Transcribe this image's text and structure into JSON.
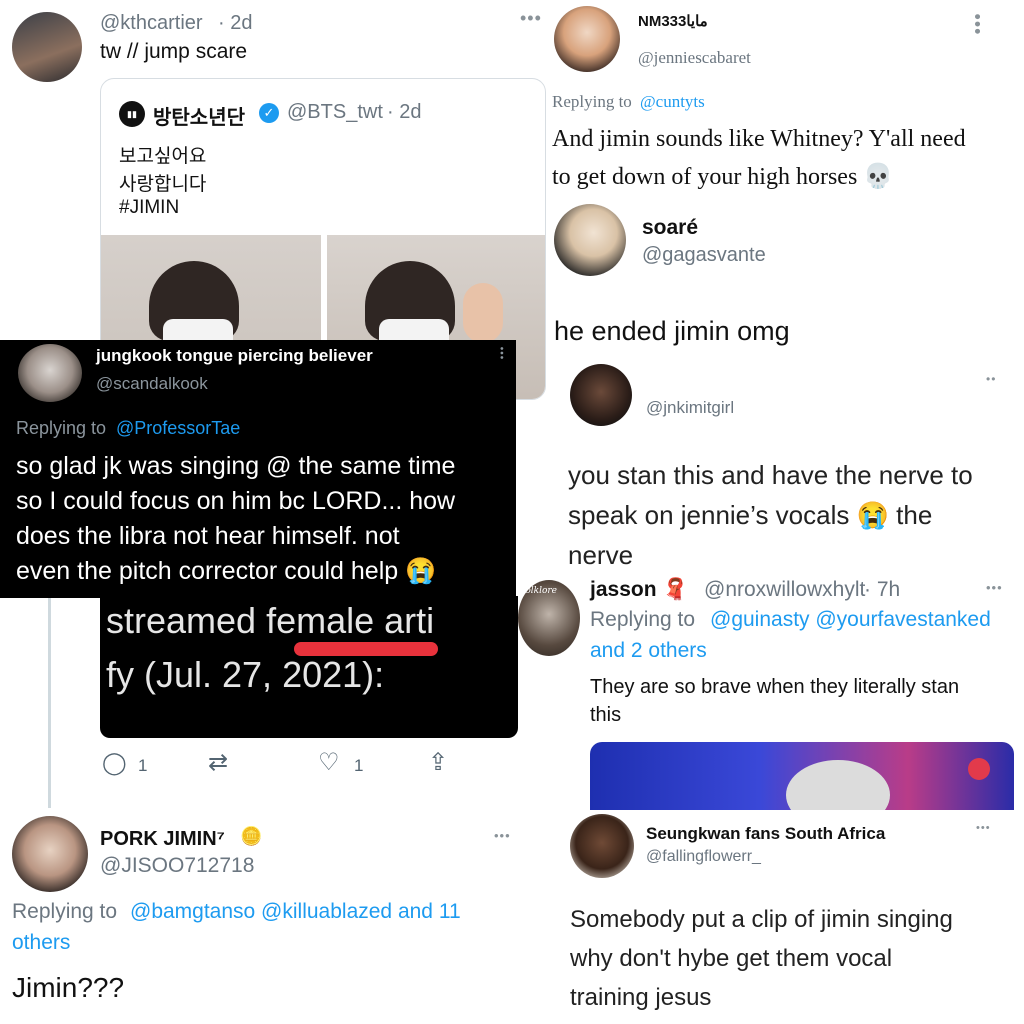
{
  "p1": {
    "name": "@kthcartier",
    "time": "· 2d",
    "text": "tw // jump scare",
    "quote": {
      "name": "방탄소년단",
      "handle": "@BTS_twt",
      "time": "· 2d",
      "line1": "보고싶어요",
      "line2": "사랑합니다",
      "line3": "#JIMIN"
    },
    "overlay": {
      "line1": "streamed female arti",
      "line2": "fy (Jul. 27, 2021):"
    },
    "actions": {
      "replies": "1",
      "likes": "1"
    }
  },
  "p2": {
    "name": "NMمايا333",
    "handle": "@jenniescabaret",
    "replying_label": "Replying to",
    "replying_to": "@cuntyts",
    "line1": "And jimin sounds like Whitney? Y'all need",
    "line2": "to get down of your high horses 💀"
  },
  "p3": {
    "name": "soaré",
    "handle": "@gagasvante",
    "text": "he ended jimin omg"
  },
  "p4": {
    "name": "jungkook tongue piercing believer",
    "handle": "@scandalkook",
    "replying_label": "Replying to",
    "replying_to": "@ProfessorTae",
    "line1": "so glad jk was singing @ the same time",
    "line2": "so I could focus on him bc LORD... how",
    "line3": "does the libra not hear himself. not",
    "line4": "even the pitch corrector could help 😭"
  },
  "p5": {
    "handle": "@jnkimitgirl",
    "line1": "you stan this and have the nerve to",
    "line2": "speak on jennie’s vocals 😭 the",
    "line3": "nerve"
  },
  "p6": {
    "name": "jasson 🧣",
    "handle": "@nroxwillowxhylt",
    "time": "· 7h",
    "replying_label": "Replying to",
    "replying_to": "@guinasty @yourfavestanked",
    "replying_more": "and 2 others",
    "line1": "They are so brave when they literally stan",
    "line2": "this",
    "avatar_text": "folklore"
  },
  "p7": {
    "name": "PORK JIMIN⁷",
    "badge": "🪙",
    "handle": "@JISOO712718",
    "replying_label": "Replying to",
    "replying_to": "@bamgtanso @killuablazed and 11",
    "replying_more": "others",
    "text": "Jimin???"
  },
  "p8": {
    "name": "Seungkwan fans South Africa",
    "handle": "@fallingflowerr_",
    "line1": "Somebody put a clip of jimin singing",
    "line2": "why don't hybe get them vocal",
    "line3": "training jesus"
  },
  "colors": {
    "blue": "#1d9bf0",
    "muted": "#6b7680",
    "dark_bg": "#000000",
    "red": "#e8323c"
  }
}
